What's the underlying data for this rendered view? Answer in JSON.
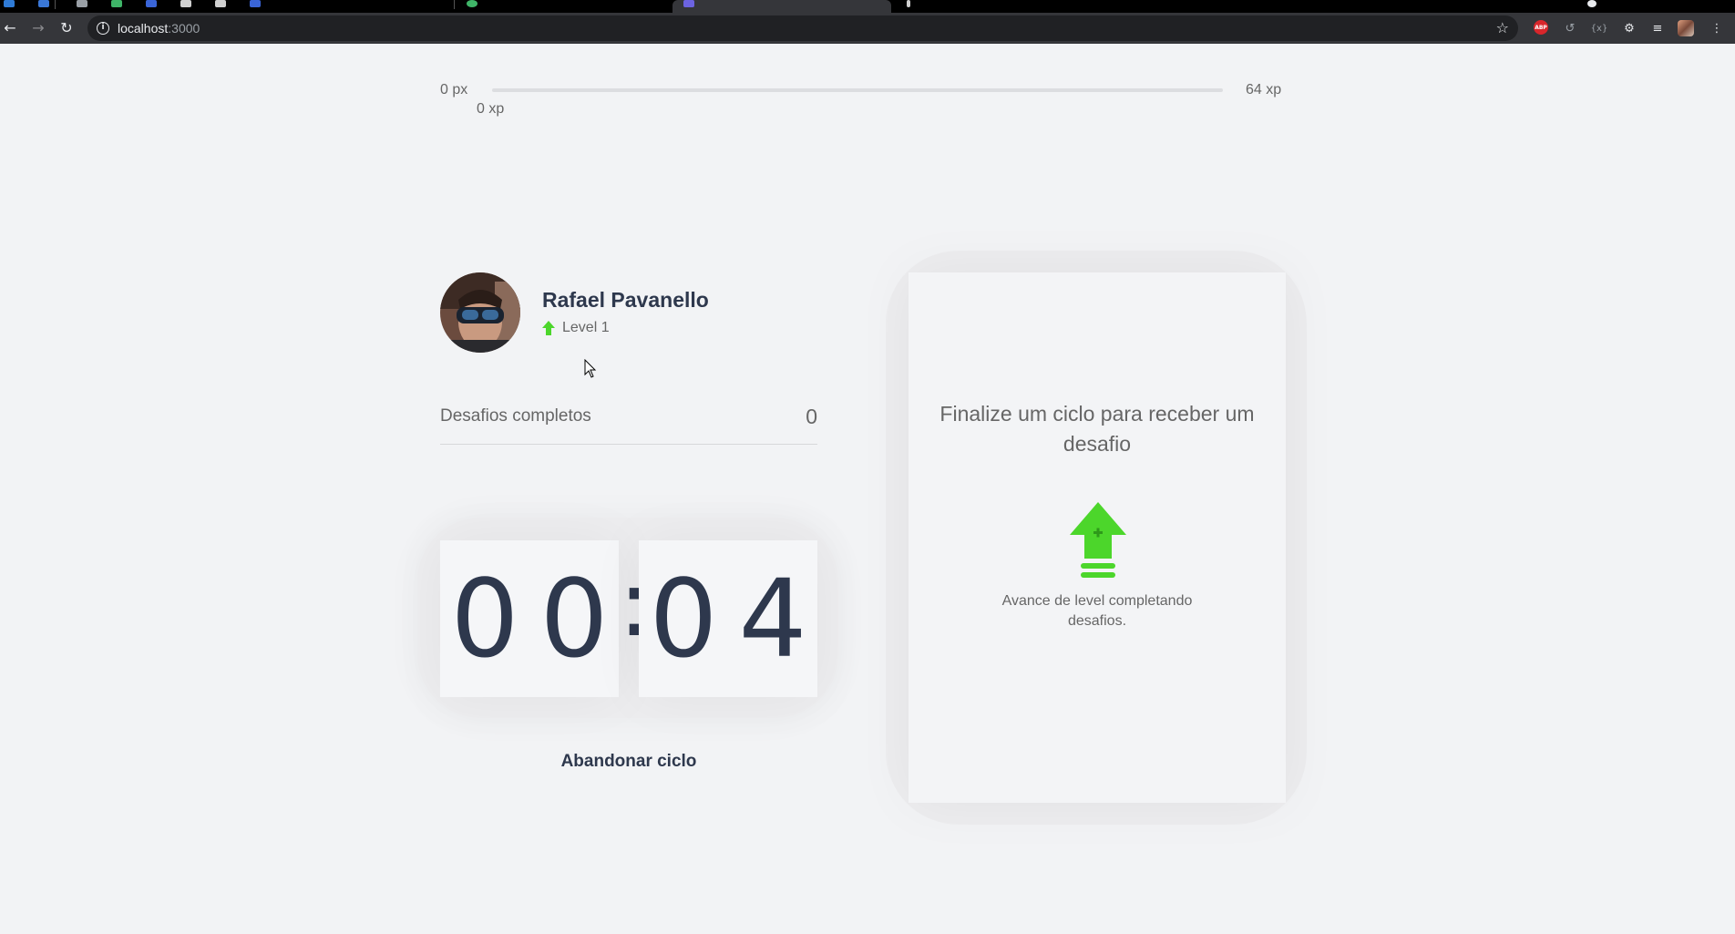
{
  "browser": {
    "url_host": "localhost",
    "url_port": ":3000"
  },
  "xp_bar": {
    "min_label": "0 px",
    "current_label": "0 xp",
    "max_label": "64 xp",
    "progress": 0
  },
  "profile": {
    "name": "Rafael Pavanello",
    "level": "Level 1"
  },
  "completed": {
    "label": "Desafios completos",
    "value": "0"
  },
  "countdown": {
    "minute_left": "0",
    "minute_right": "0",
    "separator": ":",
    "second_left": "0",
    "second_right": "4"
  },
  "abandon_button": "Abandonar ciclo",
  "challenge": {
    "title": "Finalize um ciclo para receber um desafio",
    "description": "Avance de level completando desafios."
  },
  "colors": {
    "accent_green": "#4cd62b",
    "text_title": "#2e384d",
    "text_body": "#666666"
  }
}
